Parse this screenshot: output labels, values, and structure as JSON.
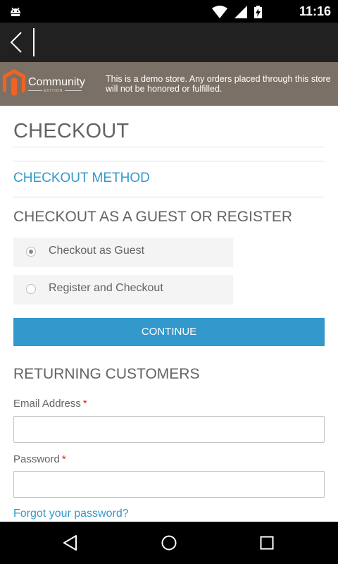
{
  "status_bar": {
    "time": "11:16"
  },
  "banner": {
    "logo_text": "Community",
    "logo_subtext": "EDITION",
    "message": "This is a demo store. Any orders placed through this store will not be honored or fulfilled."
  },
  "page": {
    "title": "CHECKOUT",
    "section": "CHECKOUT METHOD",
    "guest_heading": "CHECKOUT AS A GUEST OR REGISTER",
    "options": [
      {
        "label": "Checkout as Guest",
        "checked": true
      },
      {
        "label": "Register and Checkout",
        "checked": false
      }
    ],
    "continue_label": "CONTINUE",
    "returning_heading": "RETURNING CUSTOMERS",
    "email_label": "Email Address",
    "password_label": "Password",
    "required_mark": "*",
    "forgot_link": "Forgot your password?"
  },
  "colors": {
    "accent": "#3399cc",
    "banner_bg": "#7b7065",
    "required": "#df280a"
  }
}
